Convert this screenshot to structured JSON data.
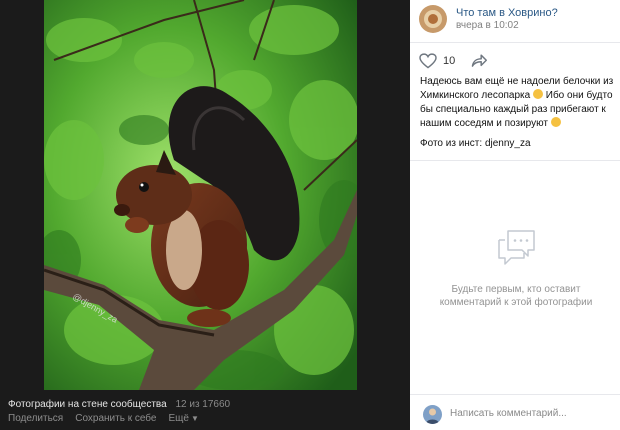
{
  "viewer": {
    "photo_alt": "squirrel-photo",
    "watermark": "@djenny_za",
    "album_title": "Фотографии на стене сообщества",
    "counter": "12 из 17660",
    "actions": {
      "share": "Поделиться",
      "save": "Сохранить к себе",
      "more": "Ещё"
    }
  },
  "post": {
    "group_name": "Что там в Ховрино?",
    "time": "вчера в 10:02",
    "likes": "10",
    "text_part1": "Надеюсь вам ещё не надоели белочки из Химкинского лесопарка ",
    "text_part2": " Ибо они будто бы специально каждый раз прибегают к нашим соседям и позируют ",
    "source": "Фото из инст: djenny_za"
  },
  "comments": {
    "empty_text": "Будьте первым, кто оставит комментарий к этой фотографии",
    "input_placeholder": "Написать комментарий..."
  },
  "colors": {
    "link": "#2a5885",
    "viewer_bg": "#1b1b1b"
  }
}
